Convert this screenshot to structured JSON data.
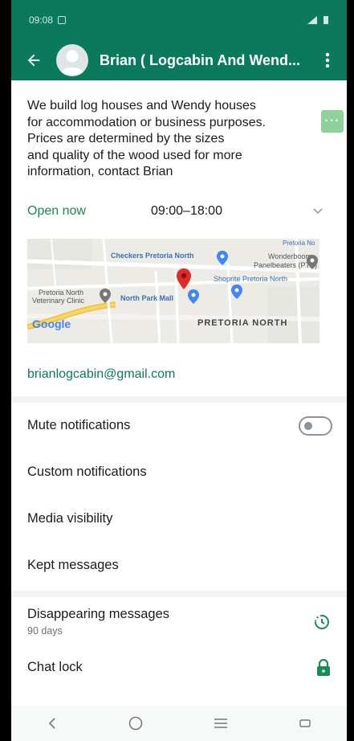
{
  "status_bar": {
    "time": "09:08"
  },
  "header": {
    "title": "Brian ( Logcabin And Wend..."
  },
  "description": {
    "lines": [
      "We build log houses and Wendy houses",
      "for accommodation or business purposes.",
      "Prices are determined by the sizes",
      "and quality of the wood used for more",
      "information, contact Brian"
    ],
    "more_label": "···"
  },
  "hours": {
    "status": "Open now",
    "range": "09:00–18:00"
  },
  "map": {
    "labels": {
      "checkers": "Checkers Pretoria North",
      "wonderboom_1": "Wonderboom",
      "wonderboom_2": "Panelbeaters (PTY)",
      "pretoria_no": "Pretoria No",
      "shoprite": "Shoprite Pretoria North",
      "vet_1": "Pretoria North",
      "vet_2": "Veterinary Clinic",
      "mall": "North Park Mall",
      "area": "PRETORIA NORTH",
      "google": "Google"
    }
  },
  "email": "brianlogcabin@gmail.com",
  "settings": {
    "mute": "Mute notifications",
    "custom": "Custom notifications",
    "media": "Media visibility",
    "kept": "Kept messages"
  },
  "disappearing": {
    "title": "Disappearing messages",
    "value": "90 days"
  },
  "chat_lock": "Chat lock",
  "colors": {
    "brand": "#0b7a5c",
    "open": "#1a8a55",
    "pin": "#e02b2b"
  },
  "icons": {
    "back": "arrow-left-icon",
    "more": "more-vert-icon",
    "chevron": "chevron-down-icon",
    "timer": "timer-icon",
    "lock": "lock-icon",
    "nav_back": "nav-back-icon",
    "nav_home": "nav-home-icon",
    "nav_recent": "nav-recents-icon"
  }
}
